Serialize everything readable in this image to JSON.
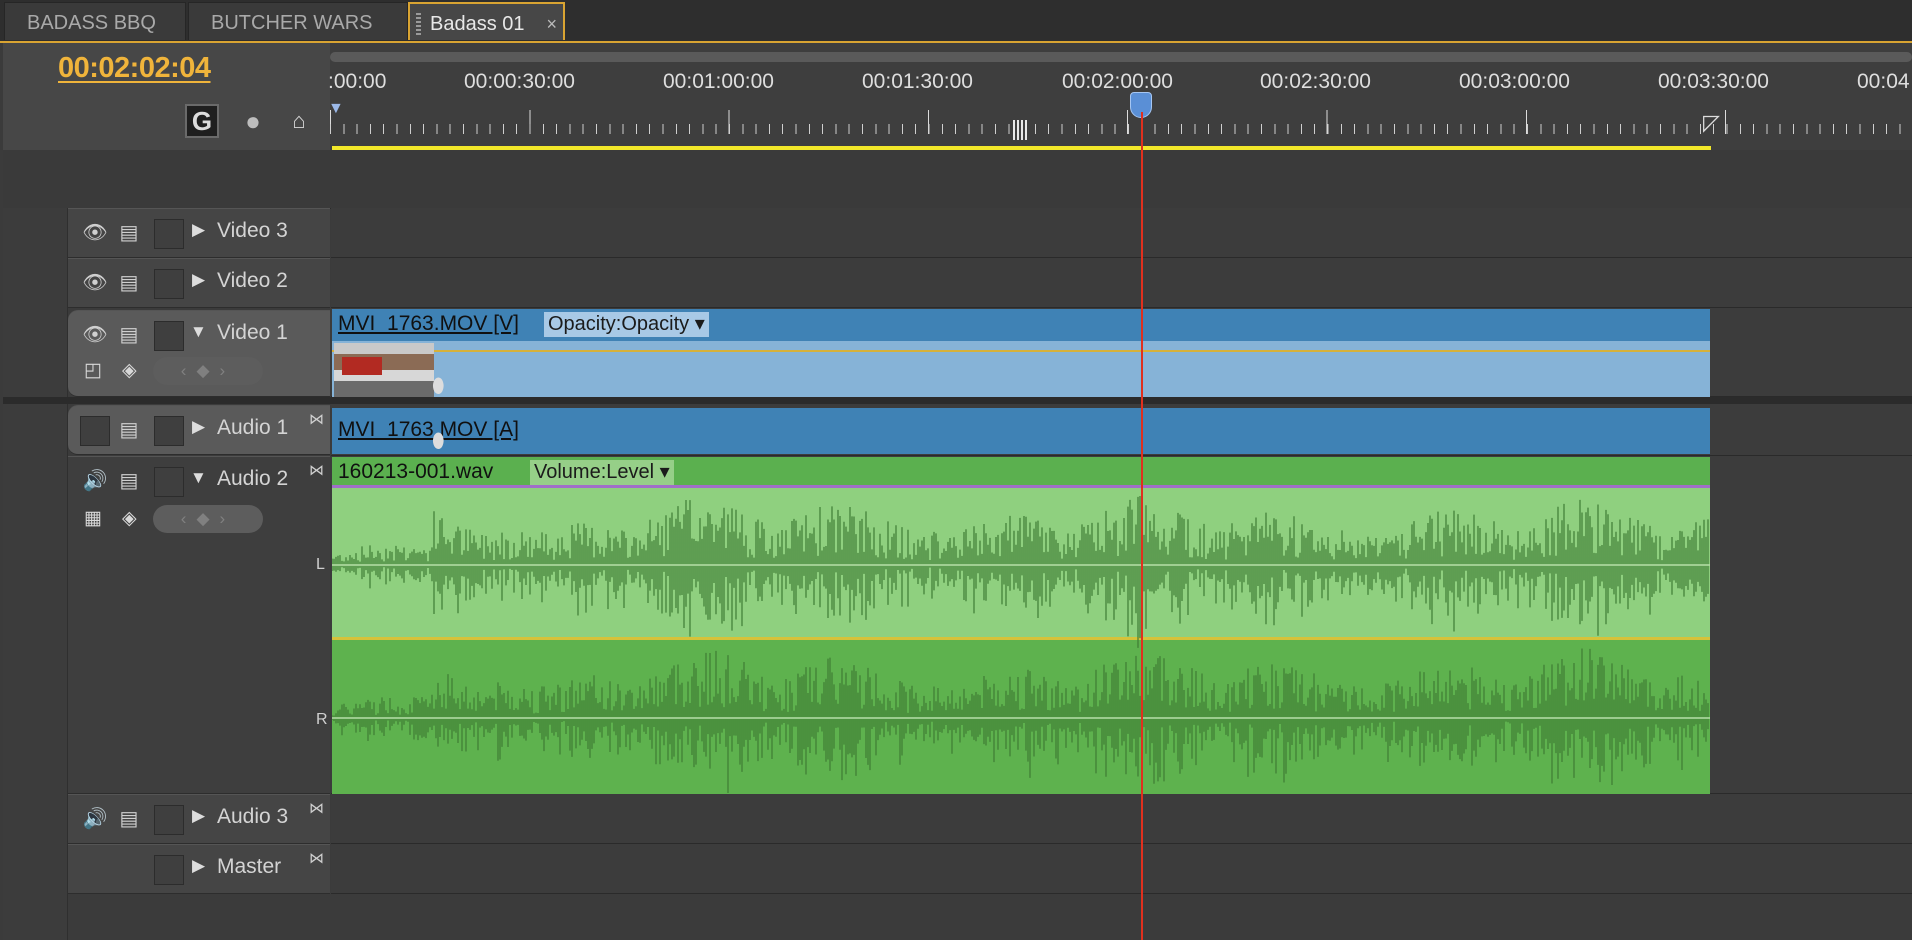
{
  "tabs": [
    {
      "label": "BADASS BBQ",
      "active": false
    },
    {
      "label": "BUTCHER WARS",
      "active": false
    },
    {
      "label": "Badass 01",
      "active": true,
      "close_icon": "×"
    }
  ],
  "timecode": "00:02:02:04",
  "header_buttons": {
    "snap_icon": "snap-magnet-icon",
    "marker_icon": "set-marker-icon",
    "home_icon": "home-icon"
  },
  "ruler": {
    "labels": [
      ":00:00",
      "00:00:30:00",
      "00:01:00:00",
      "00:01:30:00",
      "00:02:00:00",
      "00:02:30:00",
      "00:03:00:00",
      "00:03:30:00",
      "00:04"
    ]
  },
  "tracks": {
    "video3": {
      "name": "Video 3"
    },
    "video2": {
      "name": "Video 2"
    },
    "video1": {
      "name": "Video 1"
    },
    "audio1": {
      "name": "Audio 1"
    },
    "audio2": {
      "name": "Audio 2",
      "left_label": "L",
      "right_label": "R"
    },
    "audio3": {
      "name": "Audio 3"
    },
    "master": {
      "name": "Master"
    }
  },
  "clips": {
    "video1": {
      "name": "MVI_1763.MOV [V]",
      "effect": "Opacity:Opacity"
    },
    "audio1": {
      "name": "MVI_1763.MOV [A]"
    },
    "audio2": {
      "name": "160213-001.wav",
      "effect": "Volume:Level"
    }
  },
  "colors": {
    "accent": "#d9a432",
    "timecode": "#f0b43b",
    "playhead": "#e0301e",
    "video_clip": "#3f82b5",
    "audio_clip": "#5bb04f",
    "work_area": "#f2e82a"
  }
}
